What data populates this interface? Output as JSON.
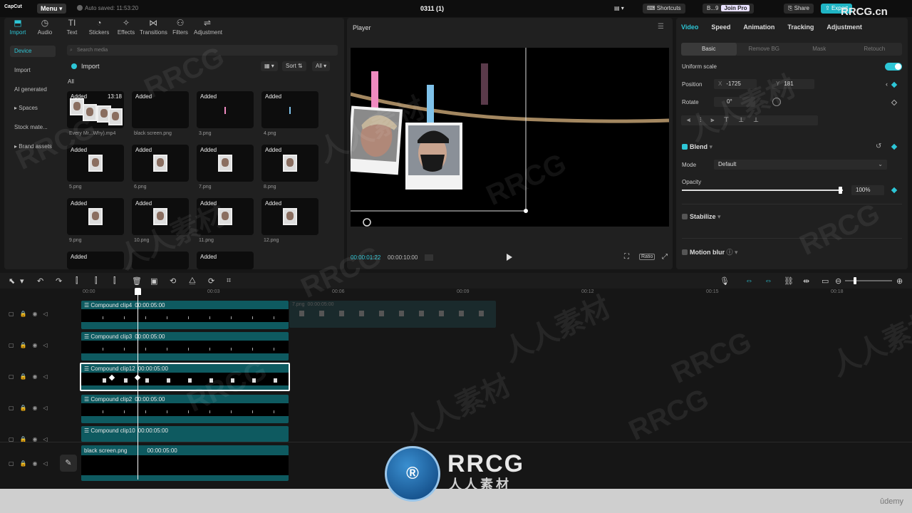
{
  "topbar": {
    "logo": "CapCut",
    "menu": "Menu",
    "autosave": "Auto saved: 11:53:20",
    "project_title": "0311 (1)",
    "shortcuts": "Shortcuts",
    "user": "B...9",
    "join_pro": "Join Pro",
    "share": "Share",
    "export": "Export"
  },
  "tools": [
    {
      "label": "Import",
      "icon": "import-icon",
      "glyph": "⬒"
    },
    {
      "label": "Audio",
      "icon": "audio-icon",
      "glyph": "◷"
    },
    {
      "label": "Text",
      "icon": "text-icon",
      "glyph": "TI"
    },
    {
      "label": "Stickers",
      "icon": "stickers-icon",
      "glyph": "◔"
    },
    {
      "label": "Effects",
      "icon": "effects-icon",
      "glyph": "✧"
    },
    {
      "label": "Transitions",
      "icon": "transitions-icon",
      "glyph": "⋈"
    },
    {
      "label": "Filters",
      "icon": "filters-icon",
      "glyph": "⚇"
    },
    {
      "label": "Adjustment",
      "icon": "adjustment-icon",
      "glyph": "⇌"
    }
  ],
  "sidenav": [
    "Device",
    "Import",
    "AI generated",
    "▸ Spaces",
    "Stock mate...",
    "▸ Brand assets"
  ],
  "media": {
    "search_placeholder": "Search media",
    "import_label": "Import",
    "sort_label": "Sort",
    "all_filter": "All",
    "all_label": "All",
    "added": "Added",
    "items": [
      {
        "name": "Every Mr...Why).mp4",
        "duration": "13:18"
      },
      {
        "name": "black screen.png",
        "duration": ""
      },
      {
        "name": "3.png",
        "duration": ""
      },
      {
        "name": "4.png",
        "duration": ""
      },
      {
        "name": "5.png",
        "duration": ""
      },
      {
        "name": "6.png",
        "duration": ""
      },
      {
        "name": "7.png",
        "duration": ""
      },
      {
        "name": "8.png",
        "duration": ""
      },
      {
        "name": "9.png",
        "duration": ""
      },
      {
        "name": "10.png",
        "duration": ""
      },
      {
        "name": "11.png",
        "duration": ""
      },
      {
        "name": "12.png",
        "duration": ""
      }
    ]
  },
  "player": {
    "title": "Player",
    "current_time": "00:00:01:22",
    "total_time": "00:00:10:00",
    "ratio": "Ratio"
  },
  "inspector": {
    "tabs": [
      "Video",
      "Speed",
      "Animation",
      "Tracking",
      "Adjustment"
    ],
    "subtabs": [
      "Basic",
      "Remove BG",
      "Mask",
      "Retouch"
    ],
    "uniform_scale": "Uniform scale",
    "position_label": "Position",
    "pos_x_axis": "X",
    "pos_x": "-1725",
    "pos_y_axis": "Y",
    "pos_y": "181",
    "rotate_label": "Rotate",
    "rotate": "0°",
    "blend": "Blend",
    "mode_label": "Mode",
    "mode_value": "Default",
    "opacity_label": "Opacity",
    "opacity_value": "100%",
    "stabilize": "Stabilize",
    "motion_blur": "Motion blur"
  },
  "timeline": {
    "ticks": [
      "00:00",
      "00:03",
      "00:06",
      "00:09",
      "00:12",
      "00:15",
      "00:18"
    ],
    "tracks": [
      {
        "name": "Compound clip4",
        "dur": "00:00:05:00"
      },
      {
        "name": "Compound clip3",
        "dur": "00:00:05:00"
      },
      {
        "name": "Compound clip12",
        "dur": "00:00:05:00"
      },
      {
        "name": "Compound clip2",
        "dur": "00:00:05:00"
      },
      {
        "name": "Compound clip10",
        "dur": "00:00:05:00"
      }
    ],
    "ghost": {
      "name": "7.png",
      "dur": "00:00:05:00"
    },
    "main_track": {
      "name": "black screen.png",
      "dur": "00:00:05:00"
    }
  },
  "watermark": {
    "corner": "RRCG.cn",
    "logo_text": "RRCG",
    "logo_sub": "人人素材",
    "repeat": [
      "RRCG",
      "人人素材"
    ]
  },
  "footer": {
    "brand": "ûdemy"
  },
  "colors": {
    "accent": "#2dc6d6",
    "clip": "#0e5a60"
  }
}
